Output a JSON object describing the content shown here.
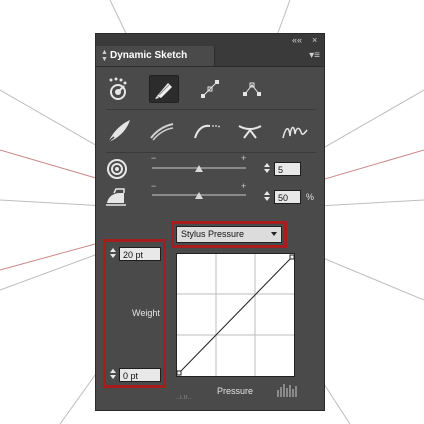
{
  "panel": {
    "title": "Dynamic Sketch",
    "collapse_glyph": "««",
    "close_glyph": "×",
    "menu_glyph": "▾≡"
  },
  "tools": {
    "row1": [
      "spray-target-icon",
      "pen-tip-icon",
      "anchor-line-icon",
      "corner-point-icon"
    ],
    "row2": [
      "brush-nib-icon",
      "strokes-icon",
      "dotted-curve-icon",
      "pinch-icon",
      "scribble-icon"
    ],
    "selected": "pen-tip-icon"
  },
  "sliders": [
    {
      "name": "rings",
      "icon": "concentric-rings-icon",
      "minus": "−",
      "plus": "+",
      "value": "5",
      "unit": "",
      "level": 0.5
    },
    {
      "name": "iron",
      "icon": "iron-icon",
      "minus": "−",
      "plus": "+",
      "value": "50",
      "unit": "%",
      "level": 0.5
    }
  ],
  "weight": {
    "max": "20 pt",
    "min": "0 pt",
    "label": "Weight"
  },
  "pressure": {
    "dropdown_value": "Stylus Pressure",
    "axis_label": "Pressure",
    "bottom_left_glyph": "..ı.ıı.."
  },
  "colors": {
    "panel_bg": "#4a4a4a",
    "highlight": "#a71c1c"
  }
}
